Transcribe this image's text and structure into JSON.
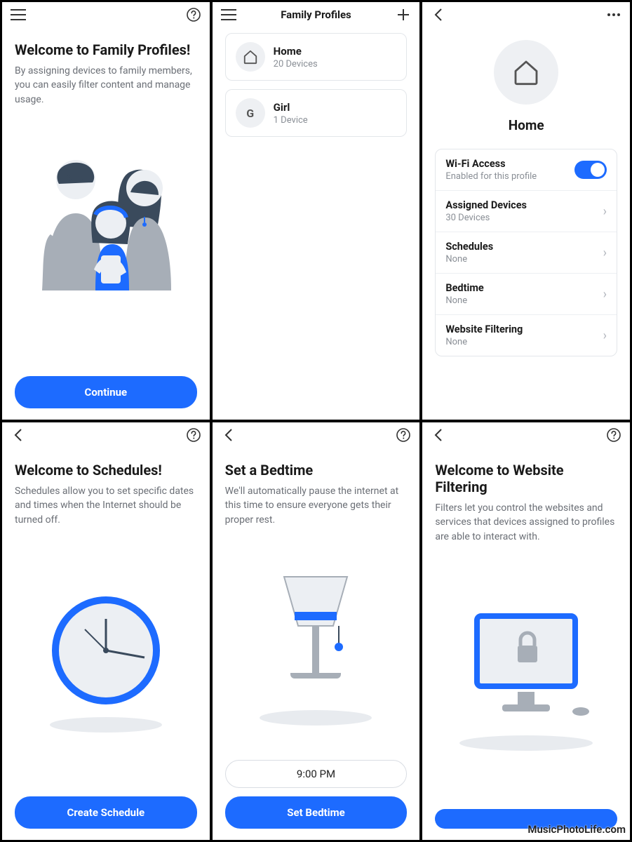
{
  "colors": {
    "accent": "#1d6bff"
  },
  "screen1": {
    "title": "Welcome to Family Profiles!",
    "subtitle": "By assigning devices to family members, you can easily filter content and manage usage.",
    "button": "Continue"
  },
  "screen2": {
    "header": "Family Profiles",
    "profiles": [
      {
        "name": "Home",
        "sub": "20 Devices",
        "avatar": "home-icon"
      },
      {
        "name": "Girl",
        "sub": "1 Device",
        "avatar": "G"
      }
    ]
  },
  "screen3": {
    "profile_title": "Home",
    "rows": {
      "wifi": {
        "title": "Wi-Fi Access",
        "sub": "Enabled for this profile",
        "enabled": true
      },
      "devices": {
        "title": "Assigned Devices",
        "sub": "30 Devices"
      },
      "schedules": {
        "title": "Schedules",
        "sub": "None"
      },
      "bedtime": {
        "title": "Bedtime",
        "sub": "None"
      },
      "filtering": {
        "title": "Website Filtering",
        "sub": "None"
      }
    }
  },
  "screen4": {
    "title": "Welcome to Schedules!",
    "subtitle": "Schedules allow you to set specific dates and times when the Internet should be turned off.",
    "button": "Create Schedule"
  },
  "screen5": {
    "title": "Set a Bedtime",
    "subtitle": "We'll automatically pause the internet at this time to ensure everyone gets their proper rest.",
    "time": "9:00 PM",
    "button": "Set Bedtime"
  },
  "screen6": {
    "title": "Welcome to Website Filtering",
    "subtitle": "Filters let you control the websites and services that devices assigned to profiles are able to interact with.",
    "button": ""
  },
  "watermark": "MusicPhotoLife.com"
}
